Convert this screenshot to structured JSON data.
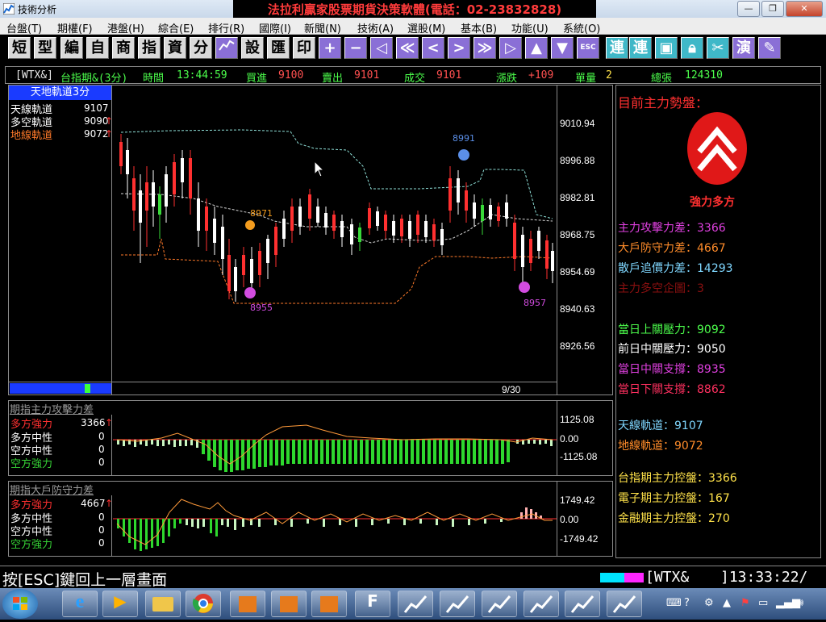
{
  "window": {
    "title": "技術分析",
    "banner": "法拉利贏家股票期貨決策軟體(電話：02-23832828)",
    "buttons": {
      "minimize": "—",
      "maximize": "❐",
      "close": "✕"
    }
  },
  "menu": [
    "台盤(T)",
    "期權(F)",
    "港盤(H)",
    "綜合(E)",
    "排行(R)",
    "國際(I)",
    "新聞(N)",
    "技術(A)",
    "選股(M)",
    "基本(B)",
    "功能(U)",
    "系統(O)"
  ],
  "toolbar": {
    "buttons": [
      "短",
      "型",
      "編",
      "自",
      "商",
      "指",
      "資",
      "分",
      "",
      "設",
      "匯",
      "印",
      "+",
      "−",
      "◁",
      "≪",
      "<",
      ">",
      "≫",
      "▷",
      "▲",
      "▼",
      "ESC",
      "連",
      "連",
      "",
      "",
      "",
      "演",
      ""
    ]
  },
  "quote": {
    "symbol": "[WTX&]",
    "name": "台指期&(3分)",
    "time_label": "時間",
    "time": "13:44:59",
    "bid_label": "買進",
    "bid": "9100",
    "ask_label": "賣出",
    "ask": "9101",
    "deal_label": "成交",
    "deal": "9101",
    "change_label": "漲跌",
    "change": "+109",
    "vol_label": "單量",
    "vol": "2",
    "total_label": "總張",
    "total": "124310"
  },
  "main_panel": {
    "title": "天地軌道3分",
    "legend": [
      {
        "label": "天線軌道",
        "value": "9107",
        "color": "#ffffff",
        "arrow": ""
      },
      {
        "label": "多空軌道",
        "value": "9090",
        "color": "#ffffff",
        "arrow": "↑"
      },
      {
        "label": "地線軌道",
        "value": "9072",
        "color": "#ff7a2a",
        "arrow": "↑"
      }
    ],
    "price_axis": [
      "9010.94",
      "8996.88",
      "8982.81",
      "8968.75",
      "8954.69",
      "8940.63",
      "8926.56"
    ],
    "marks": {
      "high": "8991",
      "mid": "8971",
      "low1": "8955",
      "low2": "8957"
    },
    "date_label": "9/30"
  },
  "sub1": {
    "title": "期指主力攻擊力差",
    "legend": [
      {
        "label": "多方強力",
        "value": "3366",
        "color": "#ff3030",
        "arrow": "↑"
      },
      {
        "label": "多方中性",
        "value": "0",
        "color": "#ffffff",
        "arrow": ""
      },
      {
        "label": "空方中性",
        "value": "0",
        "color": "#ffffff",
        "arrow": ""
      },
      {
        "label": "空方強力",
        "value": "0",
        "color": "#36d336",
        "arrow": ""
      }
    ],
    "axis": [
      "1125.08",
      "0.00",
      "-1125.08"
    ]
  },
  "sub2": {
    "title": "期指大戶防守力差",
    "legend": [
      {
        "label": "多方強力",
        "value": "4667",
        "color": "#ff3030",
        "arrow": "↑"
      },
      {
        "label": "多方中性",
        "value": "0",
        "color": "#ffffff",
        "arrow": ""
      },
      {
        "label": "空方中性",
        "value": "0",
        "color": "#ffffff",
        "arrow": ""
      },
      {
        "label": "空方強力",
        "value": "0",
        "color": "#36d336",
        "arrow": ""
      }
    ],
    "axis": [
      "1749.42",
      "0.00",
      "-1749.42"
    ]
  },
  "right_panel": {
    "title": "目前主力勢盤：",
    "status": "強力多方",
    "rows": [
      {
        "text": "主力攻擊力差：3366",
        "color": "#e040e0"
      },
      {
        "text": "大戶防守力差：4667",
        "color": "#ff8c2a"
      },
      {
        "text": "散戶追價力差：14293",
        "color": "#7fd7ff"
      },
      {
        "text": "主力多空企圖：3",
        "color": "#8a1010"
      },
      {
        "text": "當日上關壓力：9092",
        "color": "#4cff4c"
      },
      {
        "text": "前日中關壓力：9050",
        "color": "#ffffff"
      },
      {
        "text": "當日中關支撐：8935",
        "color": "#e040e0"
      },
      {
        "text": "當日下關支撐：8862",
        "color": "#ff3060"
      },
      {
        "text": "天線軌道：9107",
        "color": "#7fd7ff"
      },
      {
        "text": "地線軌道：9072",
        "color": "#ff8c2a"
      },
      {
        "text": "台指期主力控盤：3366",
        "color": "#ffe24a"
      },
      {
        "text": "電子期主力控盤：167",
        "color": "#ffe24a"
      },
      {
        "text": "金融期主力控盤：270",
        "color": "#ffe24a"
      }
    ]
  },
  "statusbar": {
    "hint": "按[ESC]鍵回上一層畫面",
    "symbol": "[WTX&",
    "time": "]13:33:22/"
  }
}
